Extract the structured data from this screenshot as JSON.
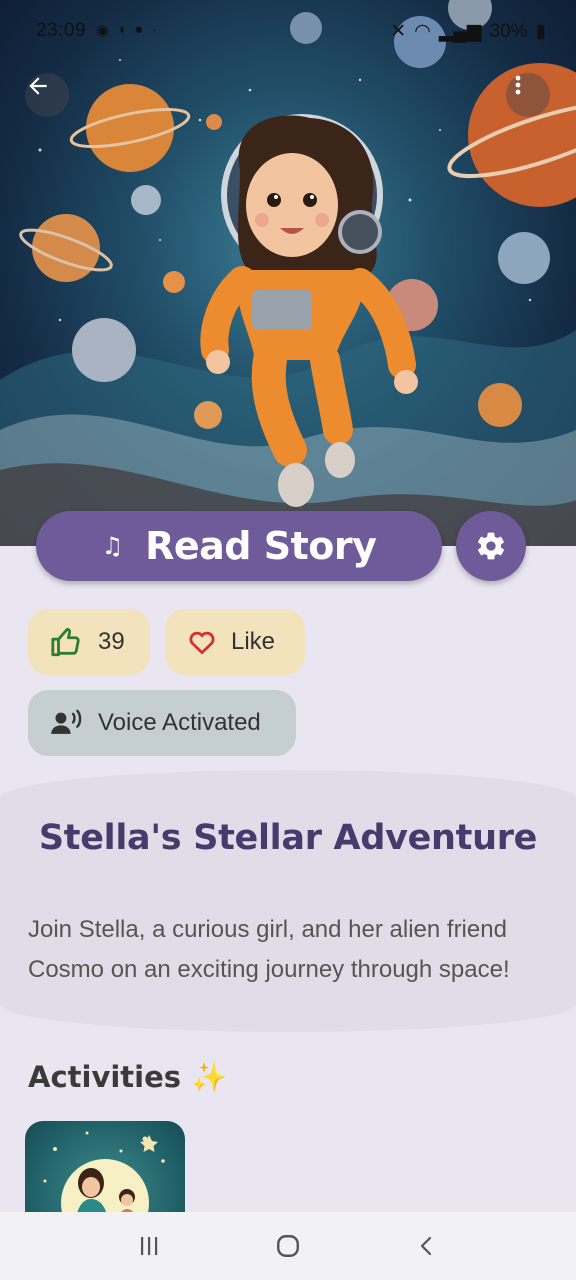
{
  "status_bar": {
    "time": "23:09",
    "battery": "30%"
  },
  "actions": {
    "read_label": "Read Story"
  },
  "stats": {
    "likes_count": "39",
    "like_label": "Like",
    "voice_label": "Voice Activated"
  },
  "story": {
    "title": "Stella's Stellar Adventure",
    "summary": "Join Stella, a curious girl, and her alien friend Cosmo on an exciting journey through space!"
  },
  "activities": {
    "title": "Activities ✨"
  },
  "colors": {
    "primary": "#6f5b99",
    "chip_warm": "#f3e3bc",
    "chip_cool": "#c5cfd2",
    "title": "#463b6c",
    "background": "#e9e6f1"
  }
}
